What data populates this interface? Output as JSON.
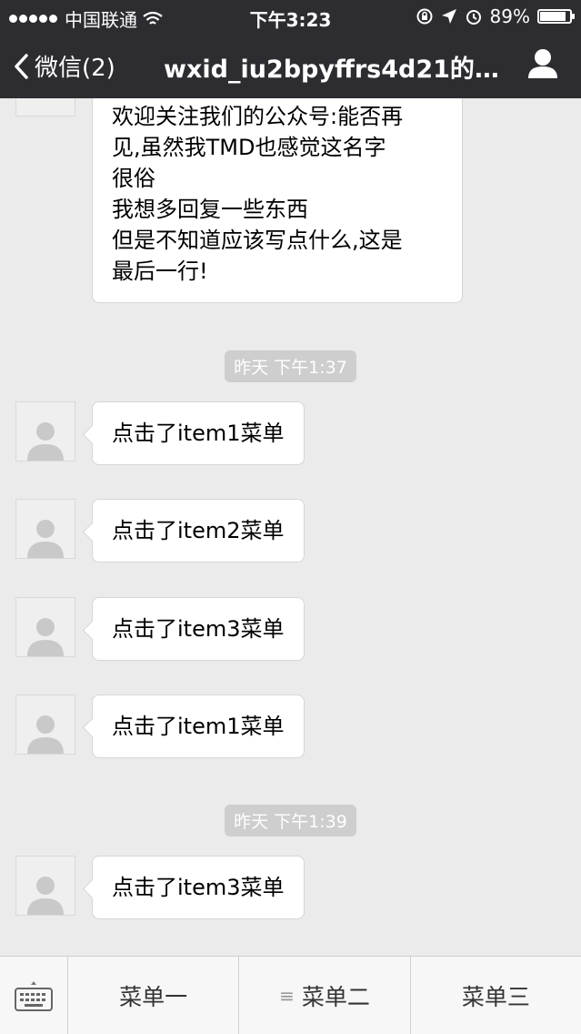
{
  "status_bar": {
    "carrier": "中国联通",
    "time": "下午3:23",
    "battery": "89%",
    "battery_level": 0.89
  },
  "nav": {
    "back_label": "微信(2)",
    "title": "wxid_iu2bpyffrs4d21的..."
  },
  "messages": [
    {
      "lines": [
        "欢迎关注我们的公众号:能否再",
        "见,虽然我TMD也感觉这名字",
        "很俗",
        "我想多回复一些东西",
        "但是不知道应该写点什么,这是",
        "最后一行!"
      ]
    }
  ],
  "timestamps": [
    "昨天 下午1:37",
    "昨天 下午1:39"
  ],
  "short_messages": [
    "点击了item1菜单",
    "点击了item2菜单",
    "点击了item3菜单",
    "点击了item1菜单",
    "点击了item3菜单"
  ],
  "menu": {
    "items": [
      "菜单一",
      "菜单二",
      "菜单三"
    ]
  },
  "colors": {
    "nav_bg": "#2d2c31",
    "chat_bg": "#ebebeb",
    "bubble_bg": "#ffffff"
  }
}
